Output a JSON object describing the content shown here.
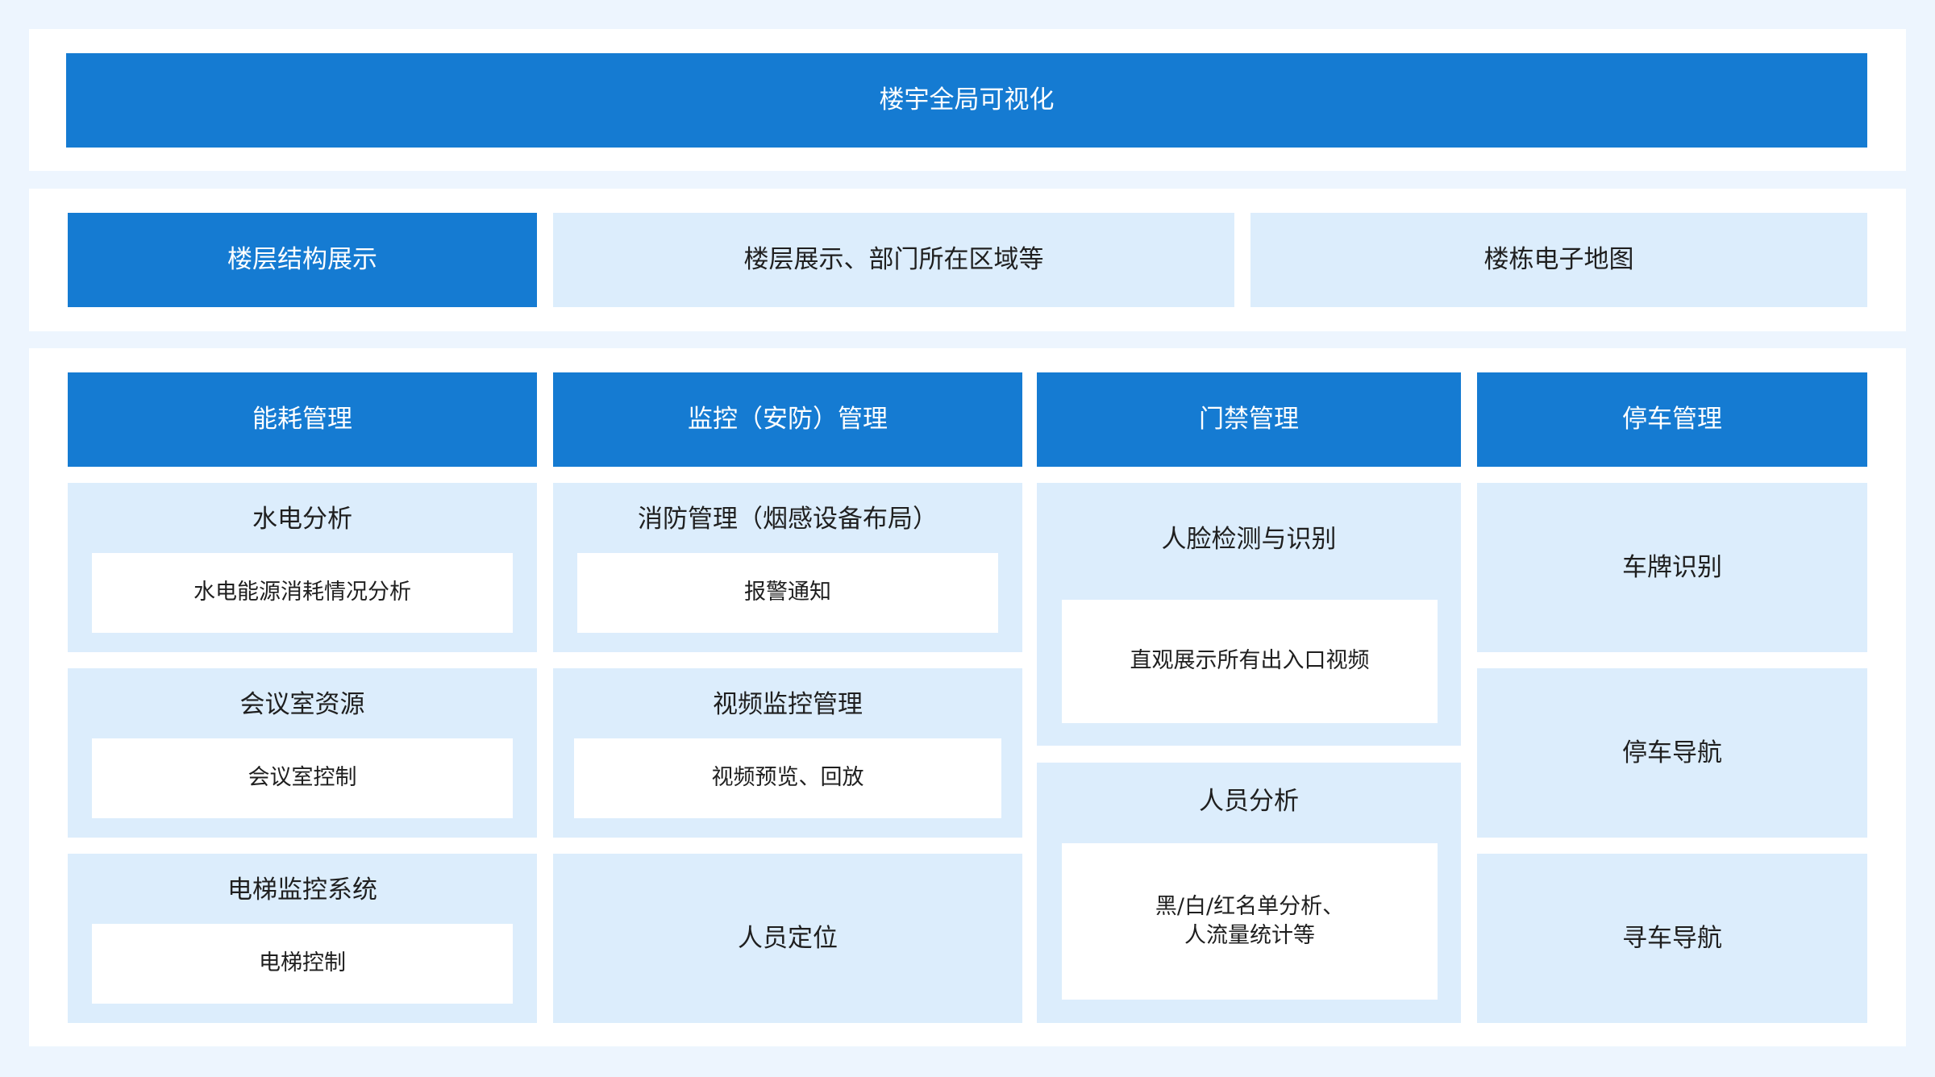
{
  "top": {
    "title": "楼宇全局可视化"
  },
  "floor": {
    "title": "楼层结构展示",
    "item1": "楼层展示、部门所在区域等",
    "item2": "楼栋电子地图"
  },
  "columns": {
    "energy": {
      "header": "能耗管理",
      "cells": [
        {
          "title": "水电分析",
          "detail": "水电能源消耗情况分析"
        },
        {
          "title": "会议室资源",
          "detail": "会议室控制"
        },
        {
          "title": "电梯监控系统",
          "detail": "电梯控制"
        }
      ]
    },
    "security": {
      "header": "监控（安防）管理",
      "cells": [
        {
          "title": "消防管理（烟感设备布局）",
          "detail": "报警通知"
        },
        {
          "title": "视频监控管理",
          "detail": "视频预览、回放"
        },
        {
          "title": "人员定位"
        }
      ]
    },
    "access": {
      "header": "门禁管理",
      "cells": [
        {
          "title": "人脸检测与识别",
          "detail": "直观展示所有出入口视频"
        },
        {
          "title": "人员分析",
          "detail_line1": "黑/白/红名单分析、",
          "detail_line2": "人流量统计等"
        }
      ]
    },
    "parking": {
      "header": "停车管理",
      "cells": [
        {
          "title": "车牌识别"
        },
        {
          "title": "停车导航"
        },
        {
          "title": "寻车导航"
        }
      ]
    }
  }
}
